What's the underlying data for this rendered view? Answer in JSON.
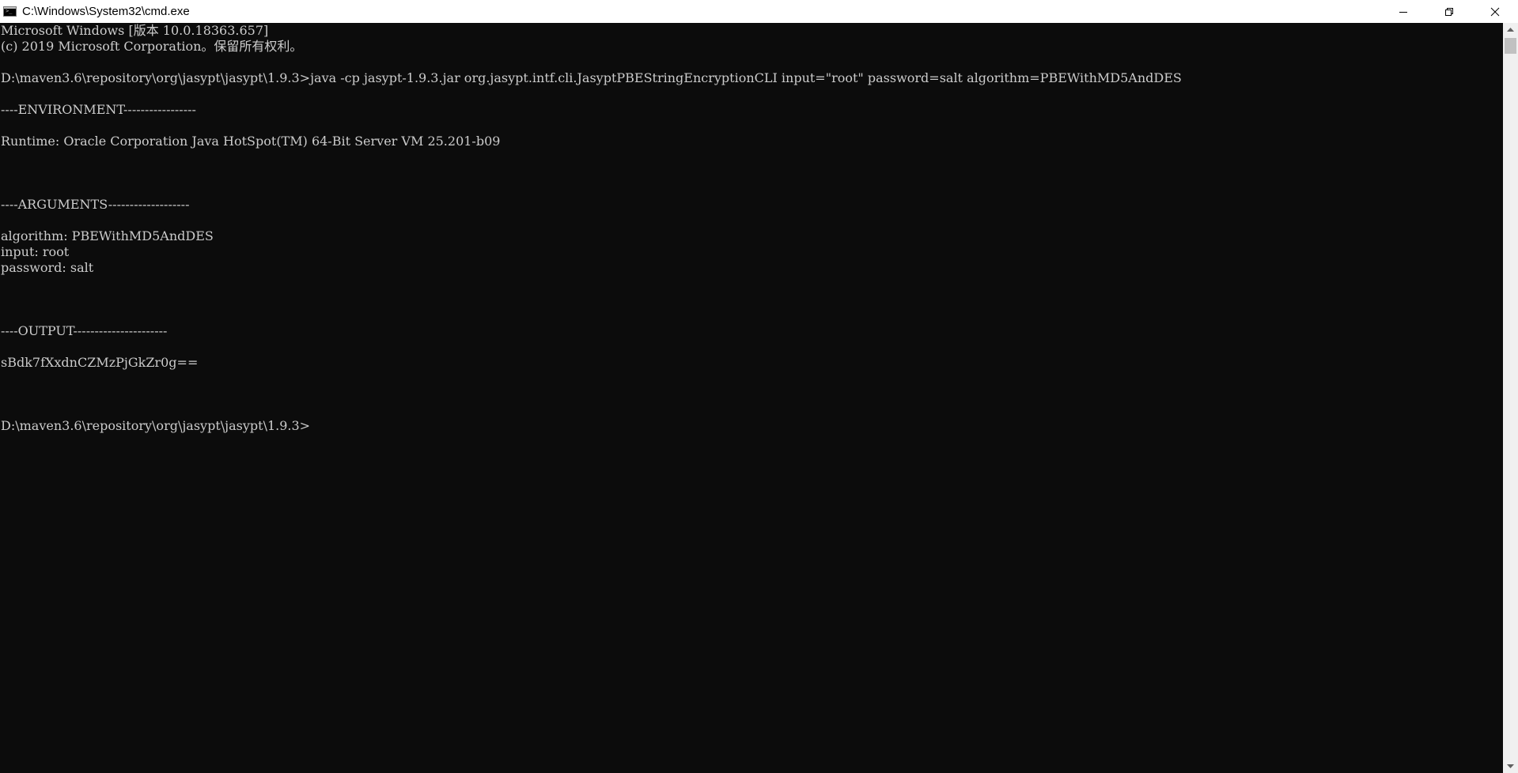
{
  "window": {
    "title": "C:\\Windows\\System32\\cmd.exe",
    "icon": "cmd-icon",
    "controls": {
      "minimize_icon": "minimize-icon",
      "maximize_icon": "restore-icon",
      "close_icon": "close-icon"
    }
  },
  "console": {
    "lines": [
      "Microsoft Windows [版本 10.0.18363.657]",
      "(c) 2019 Microsoft Corporation。保留所有权利。",
      "",
      "D:\\maven3.6\\repository\\org\\jasypt\\jasypt\\1.9.3>java -cp jasypt-1.9.3.jar org.jasypt.intf.cli.JasyptPBEStringEncryptionCLI input=\"root\" password=salt algorithm=PBEWithMD5AndDES",
      "",
      "----ENVIRONMENT-----------------",
      "",
      "Runtime: Oracle Corporation Java HotSpot(TM) 64-Bit Server VM 25.201-b09",
      "",
      "",
      "",
      "----ARGUMENTS-------------------",
      "",
      "algorithm: PBEWithMD5AndDES",
      "input: root",
      "password: salt",
      "",
      "",
      "",
      "----OUTPUT----------------------",
      "",
      "sBdk7fXxdnCZMzPjGkZr0g==",
      "",
      "",
      "",
      "D:\\maven3.6\\repository\\org\\jasypt\\jasypt\\1.9.3>"
    ]
  },
  "colors": {
    "background": "#0c0c0c",
    "text": "#cccccc",
    "titlebar": "#ffffff"
  }
}
